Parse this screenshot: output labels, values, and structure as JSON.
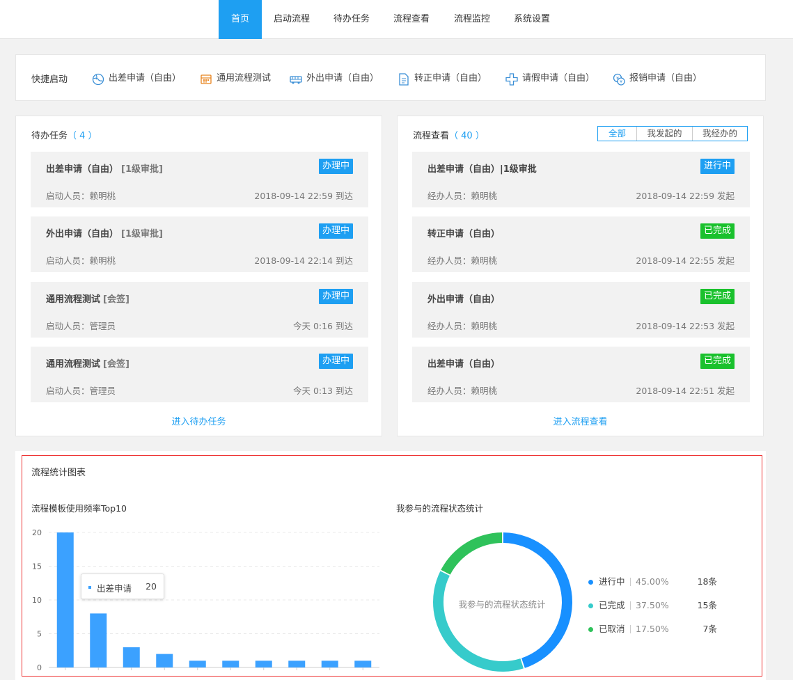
{
  "nav": {
    "items": [
      "首页",
      "启动流程",
      "待办任务",
      "流程查看",
      "流程监控",
      "系统设置"
    ]
  },
  "quick_start": {
    "title": "快捷启动",
    "items": [
      {
        "label": "出差申请（自由）",
        "icon": "globe-icon"
      },
      {
        "label": "通用流程测试",
        "icon": "calendar-icon"
      },
      {
        "label": "外出申请（自由）",
        "icon": "bus-icon"
      },
      {
        "label": "转正申请（自由）",
        "icon": "document-icon"
      },
      {
        "label": "请假申请（自由）",
        "icon": "cross-icon"
      },
      {
        "label": "报销申请（自由）",
        "icon": "coins-icon"
      }
    ]
  },
  "todo": {
    "title": "待办任务",
    "count": "（ 4 ）",
    "link": "进入待办任务",
    "items": [
      {
        "title": "出差申请（自由）",
        "sub": "[1级审批]",
        "badge": "办理中",
        "person": "启动人员：赖明桃",
        "time": "2018-09-14 22:59 到达"
      },
      {
        "title": "外出申请（自由）",
        "sub": "[1级审批]",
        "badge": "办理中",
        "person": "启动人员：赖明桃",
        "time": "2018-09-14 22:14 到达"
      },
      {
        "title": "通用流程测试",
        "sub": "[会签]",
        "badge": "办理中",
        "person": "启动人员：管理员",
        "time": "今天 0:16 到达"
      },
      {
        "title": "通用流程测试",
        "sub": "[会签]",
        "badge": "办理中",
        "person": "启动人员：管理员",
        "time": "今天 0:13 到达"
      }
    ]
  },
  "flows": {
    "title": "流程查看",
    "count": "（ 40 ）",
    "link": "进入流程查看",
    "tabs": [
      "全部",
      "我发起的",
      "我经办的"
    ],
    "items": [
      {
        "title": "出差申请（自由）|1级审批",
        "badge": "进行中",
        "status": "in-progress",
        "person": "经办人员：赖明桃",
        "time": "2018-09-14 22:59 发起"
      },
      {
        "title": "转正申请（自由）",
        "badge": "已完成",
        "status": "done",
        "person": "经办人员：赖明桃",
        "time": "2018-09-14 22:55 发起"
      },
      {
        "title": "外出申请（自由）",
        "badge": "已完成",
        "status": "done",
        "person": "经办人员：赖明桃",
        "time": "2018-09-14 22:53 发起"
      },
      {
        "title": "出差申请（自由）",
        "badge": "已完成",
        "status": "done",
        "person": "经办人员：赖明桃",
        "time": "2018-09-14 22:51 发起"
      }
    ]
  },
  "stats": {
    "title": "流程统计图表"
  },
  "colors": {
    "accent": "#1e9ff2",
    "done": "#1ac12d",
    "bar": "#3ba1ff",
    "pie_progress": "#1890ff",
    "pie_done": "#36cbcb",
    "pie_cancel": "#2fc25b",
    "border_red": "#e33"
  },
  "chart_data": [
    {
      "type": "bar",
      "title": "流程模板使用频率Top10",
      "values": [
        20,
        8,
        3,
        2,
        1,
        1,
        1,
        1,
        1,
        1
      ],
      "ylim": [
        0,
        20
      ],
      "yticks": [
        0,
        5,
        10,
        15,
        20
      ],
      "grid": true,
      "tooltip": {
        "label": "出差申请",
        "value": 20
      }
    },
    {
      "type": "pie",
      "title": "我参与的流程状态统计",
      "center_label": "我参与的流程状态统计",
      "legend_position": "right",
      "slices": [
        {
          "name": "进行中",
          "percent": "45.00%",
          "count": "18条",
          "value": 18,
          "color": "#1890ff"
        },
        {
          "name": "已完成",
          "percent": "37.50%",
          "count": "15条",
          "value": 15,
          "color": "#36cbcb"
        },
        {
          "name": "已取消",
          "percent": "17.50%",
          "count": "7条",
          "value": 7,
          "color": "#2fc25b"
        }
      ]
    }
  ]
}
